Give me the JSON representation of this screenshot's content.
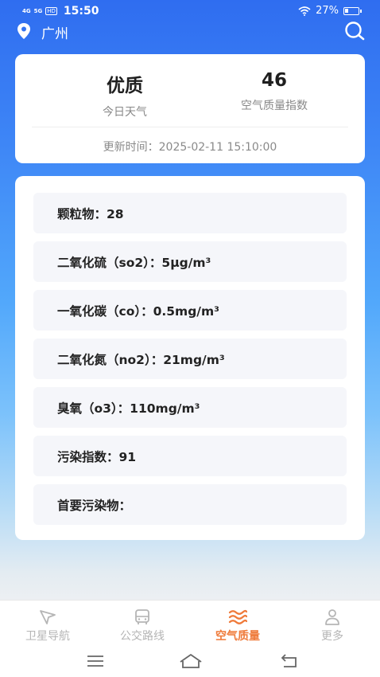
{
  "status": {
    "sig1": "4G",
    "sig2": "5G",
    "hd": "HD",
    "time": "15:50",
    "battery": "27%",
    "battery_level": 0.27
  },
  "header": {
    "city": "广州"
  },
  "summary": {
    "quality": "优质",
    "quality_label": "今日天气",
    "aqi": "46",
    "aqi_label": "空气质量指数",
    "update": "更新时间：2025-02-11 15:10:00"
  },
  "details": [
    "颗粒物：28",
    "二氧化硫（so2）：5μg/m³",
    "一氧化碳（co）：0.5mg/m³",
    "二氧化氮（no2）：21mg/m³",
    "臭氧（o3）：110mg/m³",
    "污染指数：91",
    "首要污染物："
  ],
  "tabs": [
    {
      "label": "卫星导航",
      "icon": "navigation-arrow-icon"
    },
    {
      "label": "公交路线",
      "icon": "bus-icon"
    },
    {
      "label": "空气质量",
      "icon": "air-waves-icon",
      "active": true
    },
    {
      "label": "更多",
      "icon": "user-icon"
    }
  ],
  "colors": {
    "accent": "#ef7a3a",
    "header_blue": "#2f6df0",
    "row_bg": "#f5f6fa"
  }
}
